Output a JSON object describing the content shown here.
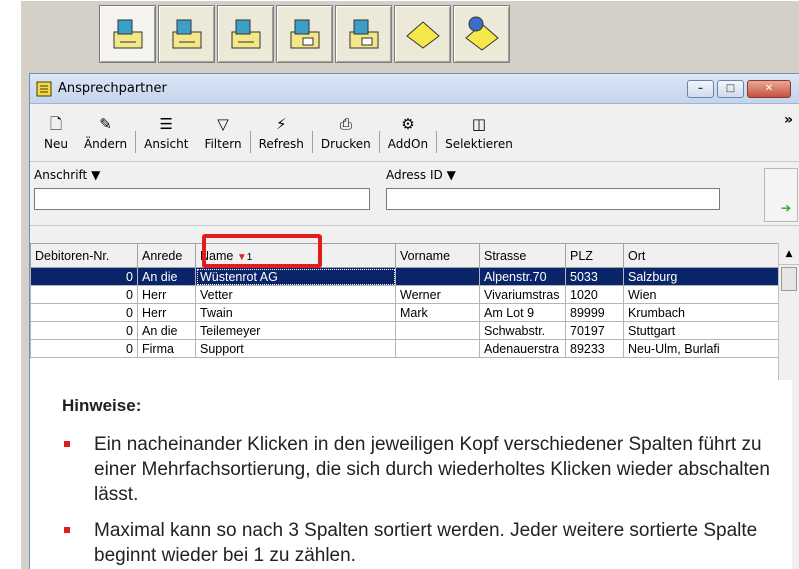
{
  "window": {
    "title": "Ansprechpartner",
    "min_glyph": "–",
    "max_glyph": "□",
    "close_glyph": "✕"
  },
  "ribbon": [
    {
      "label": "Neu",
      "icon": "new-document-icon",
      "glyph": "🗋"
    },
    {
      "label": "Ändern",
      "icon": "edit-icon",
      "glyph": "✎"
    },
    {
      "label": "Ansicht",
      "icon": "view-icon",
      "glyph": "☰"
    },
    {
      "label": "Filtern",
      "icon": "filter-icon",
      "glyph": "▽"
    },
    {
      "label": "Refresh",
      "icon": "refresh-icon",
      "glyph": "⚡"
    },
    {
      "label": "Drucken",
      "icon": "print-icon",
      "glyph": "⎙"
    },
    {
      "label": "AddOn",
      "icon": "addon-icon",
      "glyph": "⚙"
    },
    {
      "label": "Selektieren",
      "icon": "select-icon",
      "glyph": "◫"
    }
  ],
  "more_glyph": "»",
  "filters": {
    "left_label": "Anschrift ▼",
    "left_value": "",
    "right_label": "Adress ID ▼",
    "right_value": "",
    "go_glyph": "➔"
  },
  "grid": {
    "columns": [
      "Debitoren-Nr.",
      "Anrede",
      "Name",
      "Vorname",
      "Strasse",
      "PLZ",
      "Ort"
    ],
    "sort_marker": "▼",
    "sort_index": "1",
    "rows": [
      [
        "0",
        "An die",
        "Wüstenrot AG",
        "",
        "Alpenstr.70",
        "5033",
        "Salzburg"
      ],
      [
        "0",
        "Herr",
        "Vetter",
        "Werner",
        "Vivariumstras",
        "1020",
        "Wien"
      ],
      [
        "0",
        "Herr",
        "Twain",
        "Mark",
        "Am Lot 9",
        "89999",
        "Krumbach"
      ],
      [
        "0",
        "An die",
        "Teilemeyer",
        "",
        "Schwabstr.",
        "70197",
        "Stuttgart"
      ],
      [
        "0",
        "Firma",
        "Support",
        "",
        "Adenauerstra",
        "89233",
        "Neu-Ulm, Burlafi"
      ]
    ],
    "selected_row": 0
  },
  "hints": {
    "title": "Hinweise:",
    "items": [
      "Ein nacheinander Klicken in den jeweiligen Kopf verschiedener Spalten führt zu einer Mehrfachsortierung, die sich durch wiederholtes Klicken wieder abschalten lässt.",
      "Maximal kann so nach 3 Spalten sortiert werden. Jeder weitere sortierte Spalte beginnt wieder bei 1 zu zählen."
    ]
  },
  "top_toolbar": [
    "address-book-icon",
    "address-book-icon",
    "address-book-icon",
    "address-book-cards-icon",
    "address-book-cards-icon",
    "notepad-icon",
    "notepad-globe-icon"
  ],
  "colors": {
    "selection": "#0a246a",
    "highlight": "#e01c1c",
    "sort_arrow": "#e02020"
  }
}
